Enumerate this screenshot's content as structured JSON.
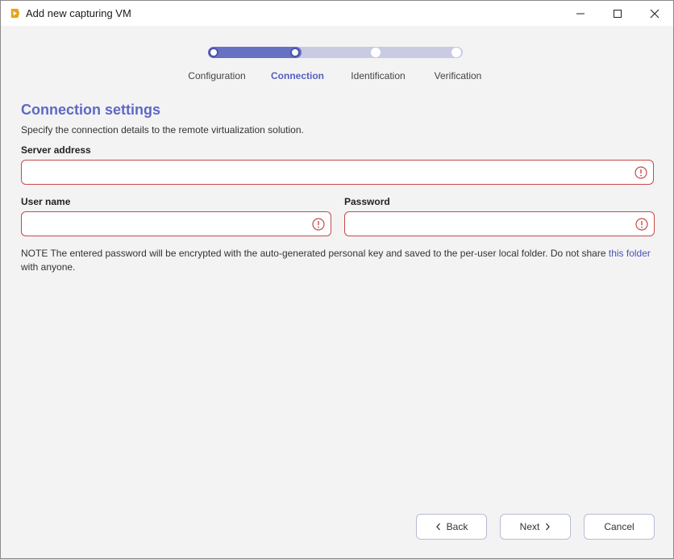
{
  "window": {
    "title": "Add new capturing VM",
    "accent_color": "#e8a21a"
  },
  "stepper": {
    "progress_fraction": 0.33,
    "steps": [
      {
        "label": "Configuration",
        "state": "done"
      },
      {
        "label": "Connection",
        "state": "active"
      },
      {
        "label": "Identification",
        "state": "todo"
      },
      {
        "label": "Verification",
        "state": "todo"
      }
    ]
  },
  "section": {
    "title": "Connection settings",
    "description": "Specify the connection details to the remote virtualization solution."
  },
  "fields": {
    "server_address": {
      "label": "Server address",
      "value": "",
      "state": "error"
    },
    "user_name": {
      "label": "User name",
      "value": "",
      "state": "error"
    },
    "password": {
      "label": "Password",
      "value": "",
      "state": "error"
    }
  },
  "note": {
    "text": "NOTE The entered password will be encrypted with the auto-generated personal key and saved to the per-user local folder. Do not share ",
    "link_text": "this folder",
    "tail": " with anyone."
  },
  "footer": {
    "back_label": "Back",
    "next_label": "Next",
    "cancel_label": "Cancel"
  },
  "colors": {
    "primary": "#5d68c6",
    "error": "#c74a4a",
    "link": "#4a56b8"
  }
}
